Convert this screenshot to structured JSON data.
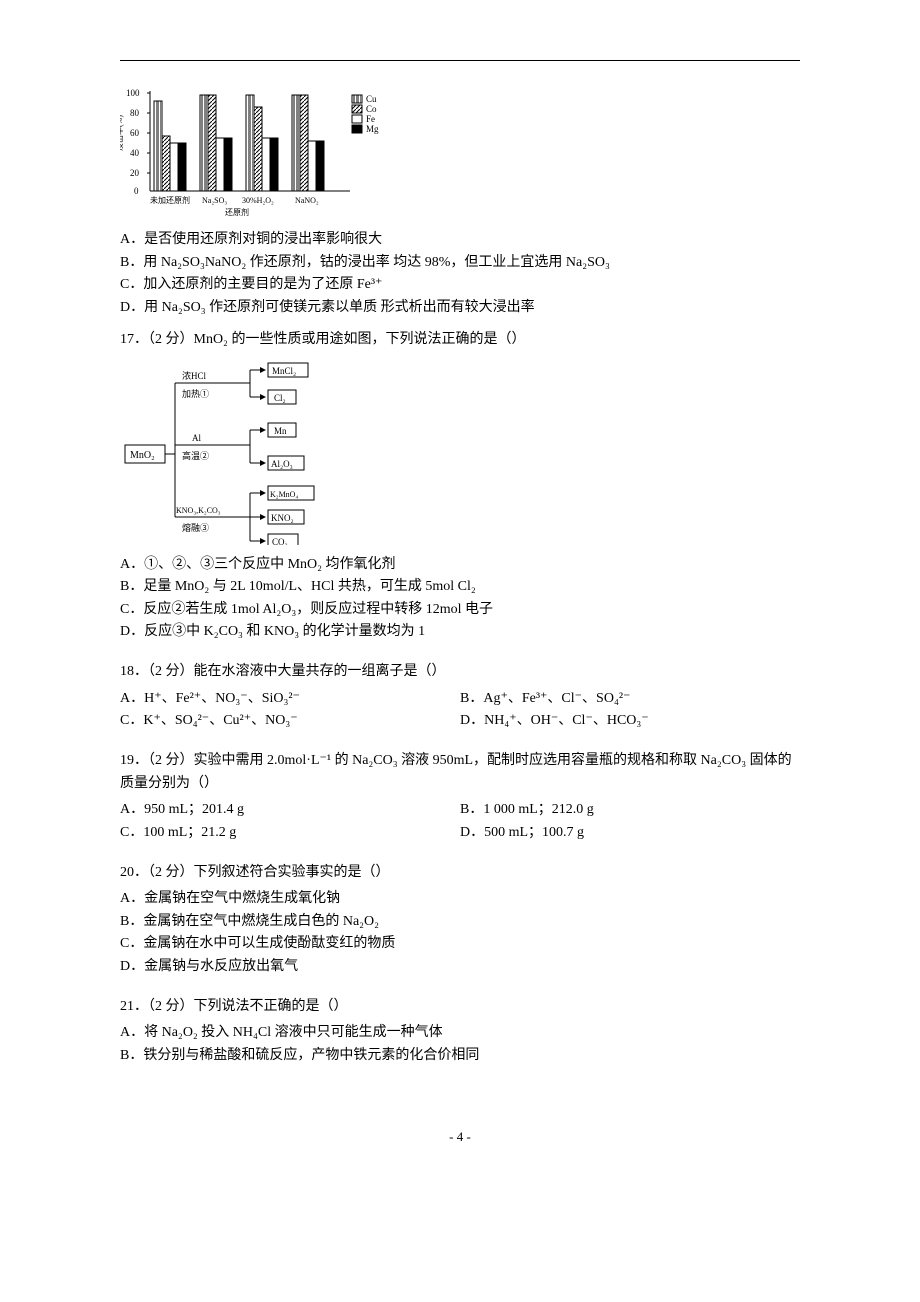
{
  "page_number": "- 4 -",
  "chart_data": {
    "type": "bar",
    "title": "",
    "xlabel": "还原剂",
    "ylabel": "浸出率 (%)",
    "ylim": [
      0,
      100
    ],
    "categories": [
      "未加还原剂",
      "Na₂SO₃",
      "30%H₂O₂",
      "NaNO₂"
    ],
    "series": [
      {
        "name": "Cu",
        "values": [
          92,
          98,
          98,
          98
        ]
      },
      {
        "name": "Co",
        "values": [
          58,
          98,
          85,
          98
        ]
      },
      {
        "name": "Fe",
        "values": [
          50,
          55,
          55,
          52
        ]
      },
      {
        "name": "Mg",
        "values": [
          50,
          55,
          55,
          52
        ]
      }
    ],
    "legend_labels": [
      "Cu",
      "Co",
      "Fe",
      "Mg"
    ]
  },
  "q16_options": {
    "A": "A．是否使用还原剂对铜的浸出率影响很大",
    "B": "B．用 Na₂SO₃NaNO₂ 作还原剂，钴的浸出率 均达 98%，但工业上宜选用 Na₂SO₃",
    "C": "C．加入还原剂的主要目的是为了还原 Fe³⁺",
    "D": "D．用 Na₂SO₃ 作还原剂可使镁元素以单质 形式析出而有较大浸出率"
  },
  "q17": {
    "stem": "17．（2 分）MnO₂ 的一些性质或用途如图，下列说法正确的是（）",
    "diagram": {
      "root": "MnO₂",
      "branches": [
        {
          "cond": "浓HCl",
          "sub": "加热①",
          "out": [
            "MnCl₂",
            "Cl₂"
          ]
        },
        {
          "cond": "Al",
          "sub": "高温②",
          "out": [
            "Mn",
            "Al₂O₃"
          ]
        },
        {
          "cond": "KNO₃, K₂CO₃",
          "sub": "熔融③",
          "out": [
            "K₂MnO₄",
            "KNO₂",
            "CO₂"
          ]
        }
      ]
    },
    "A": "A．①、②、③三个反应中 MnO₂ 均作氧化剂",
    "B": "B．足量 MnO₂ 与 2L 10mol/L、HCl 共热，可生成 5mol Cl₂",
    "C": "C．反应②若生成 1mol Al₂O₃，则反应过程中转移 12mol 电子",
    "D": "D．反应③中 K₂CO₃ 和 KNO₃ 的化学计量数均为 1"
  },
  "q18": {
    "stem": "18．（2 分）能在水溶液中大量共存的一组离子是（）",
    "A": "A．H⁺、Fe²⁺、NO₃⁻、SiO₃²⁻",
    "B": "B．Ag⁺、Fe³⁺、Cl⁻、SO₄²⁻",
    "C": "C．K⁺、SO₄²⁻、Cu²⁺、NO₃⁻",
    "D": "D．NH₄⁺、OH⁻、Cl⁻、HCO₃⁻"
  },
  "q19": {
    "stem": "19．（2 分）实验中需用 2.0mol·L⁻¹ 的 Na₂CO₃ 溶液 950mL，配制时应选用容量瓶的规格和称取 Na₂CO₃ 固体的质量分别为（）",
    "A": "A．950 mL；201.4 g",
    "B": "B．1 000 mL；212.0 g",
    "C": "C．100 mL；21.2 g",
    "D": "D．500 mL；100.7 g"
  },
  "q20": {
    "stem": "20．（2 分）下列叙述符合实验事实的是（）",
    "A": "A．金属钠在空气中燃烧生成氧化钠",
    "B": "B．金属钠在空气中燃烧生成白色的 Na₂O₂",
    "C": "C．金属钠在水中可以生成使酚酞变红的物质",
    "D": "D．金属钠与水反应放出氧气"
  },
  "q21": {
    "stem": "21．（2 分）下列说法不正确的是（）",
    "A": "A．将 Na₂O₂ 投入 NH₄Cl 溶液中只可能生成一种气体",
    "B": "B．铁分别与稀盐酸和硫反应，产物中铁元素的化合价相同"
  },
  "axis_labels": {
    "untreated": "未加还原剂",
    "na2so3": "Na₂SO₃",
    "h2o2": "30%H₂O₂",
    "nano2": "NaNO₂",
    "reductant_axis": "还原剂"
  }
}
